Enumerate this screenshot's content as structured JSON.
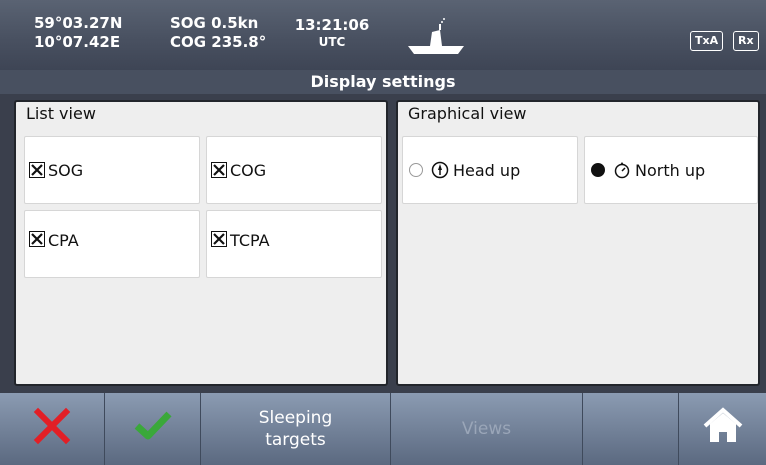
{
  "status": {
    "lat": "59°03.27N",
    "lon": "10°07.42E",
    "sog": "SOG 0.5kn",
    "cog": "COG 235.8°",
    "time": "13:21:06",
    "tz": "UTC",
    "badge_txa": "TxA",
    "badge_rx": "Rx",
    "ship_icon": "ship-icon"
  },
  "title": "Display settings",
  "list_view": {
    "title": "List view",
    "items": [
      {
        "label": "SOG",
        "checked": true
      },
      {
        "label": "COG",
        "checked": true
      },
      {
        "label": "CPA",
        "checked": true
      },
      {
        "label": "TCPA",
        "checked": true
      }
    ]
  },
  "graphical_view": {
    "title": "Graphical view",
    "options": [
      {
        "label": "Head up",
        "selected": false,
        "icon": "compass-head-up-icon"
      },
      {
        "label": "North up",
        "selected": true,
        "icon": "compass-north-up-icon"
      }
    ]
  },
  "toolbar": {
    "cancel_icon": "close-icon",
    "confirm_icon": "check-icon",
    "sleeping_line1": "Sleeping",
    "sleeping_line2": "targets",
    "views_label": "Views",
    "home_icon": "home-icon",
    "colors": {
      "cancel": "#e21f26",
      "confirm": "#3aa83a",
      "disabled_text": "#9aa6b8"
    }
  }
}
